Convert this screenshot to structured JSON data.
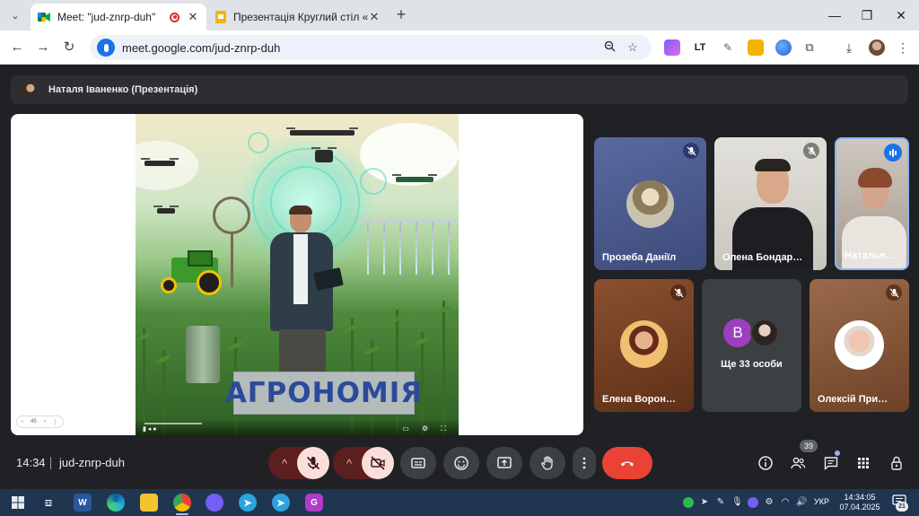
{
  "browser": {
    "tabs": [
      {
        "title": "Meet: \"jud-znrp-duh\"",
        "close": "✕"
      },
      {
        "title": "Презентація Круглий стіл «Мо",
        "close": "✕"
      }
    ],
    "new_tab": "+",
    "window_controls": {
      "minimize": "—",
      "restore": "❐",
      "close": "✕"
    },
    "url": "meet.google.com/jud-znrp-duh"
  },
  "meet": {
    "presenter_label": "Наталя Іваненко (Презентація)",
    "slide": {
      "title": "АГРОНОМІЯ",
      "zoom_level": "45"
    },
    "participants": [
      {
        "name": "Прозеба Даніїл",
        "muted": true,
        "tile_color": "#4a5a8a"
      },
      {
        "name": "Олена Бондар…",
        "muted": true,
        "tile_color": "#d8d6d0"
      },
      {
        "name": "Наталья…",
        "muted": false,
        "speaking": true,
        "tile_color": "#b7aea5"
      },
      {
        "name": "Елена Ворон…",
        "muted": true,
        "tile_color": "#7a4428"
      },
      {
        "name": "Ще 33 особи",
        "more_initial": "В"
      },
      {
        "name": "Олексій При…",
        "muted": true,
        "tile_color": "#8a5a3e"
      }
    ],
    "bottom_bar": {
      "time": "14:34",
      "meeting_code": "jud-znrp-duh",
      "people_count": "39",
      "end_call_color": "#ea4335"
    }
  },
  "taskbar": {
    "language": "УКР",
    "clock_time": "14:34:05",
    "clock_date": "07.04.2025",
    "notifications": "21"
  }
}
